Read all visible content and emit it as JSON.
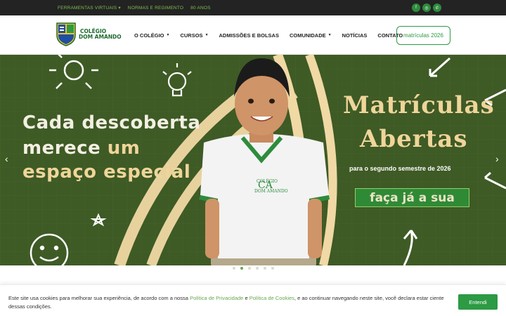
{
  "topbar": {
    "links": [
      "FERRAMENTAS VIRTUAIS",
      "NORMAS E REGIMENTO",
      "80 ANOS"
    ],
    "social_icons": [
      "facebook-icon",
      "instagram-icon",
      "whatsapp-icon"
    ]
  },
  "header": {
    "logo_line1": "COLÉGIO",
    "logo_line2": "DOM AMANDO",
    "nav": [
      {
        "label": "O COLÉGIO",
        "dropdown": true
      },
      {
        "label": "CURSOS",
        "dropdown": true
      },
      {
        "label": "ADMISSÕES E BOLSAS",
        "dropdown": false
      },
      {
        "label": "COMUNIDADE",
        "dropdown": true
      },
      {
        "label": "NOTÍCIAS",
        "dropdown": false
      },
      {
        "label": "CONTATO",
        "dropdown": false
      }
    ],
    "cta_label": "matrículas 2026"
  },
  "hero": {
    "headline_line1": "Cada descoberta",
    "headline_line2a": "merece",
    "headline_line2b": "um",
    "headline_line3": "espaço especial",
    "right_title_1": "Matrículas",
    "right_title_2": "Abertas",
    "subtitle": "para o segundo semestre de 2026",
    "badge": "faça já a sua",
    "shirt_logo": "Colégio Dom Amando",
    "prev_arrow": "‹",
    "next_arrow": "›",
    "slide_count": 6,
    "active_slide": 2
  },
  "cookie": {
    "text_1": "Este site usa cookies para melhorar sua experiência, de acordo com a nossa ",
    "link_privacy": "Política de Privacidade",
    "text_2": " e ",
    "link_cookies": "Política de Cookies",
    "text_3": ", e ao continuar navegando neste site, você declara estar ciente dessas condições.",
    "button": "Entendi"
  },
  "colors": {
    "brand_green": "#2d9a44",
    "chalkboard": "#3e5a25",
    "accent_yellow": "#efd59a"
  }
}
